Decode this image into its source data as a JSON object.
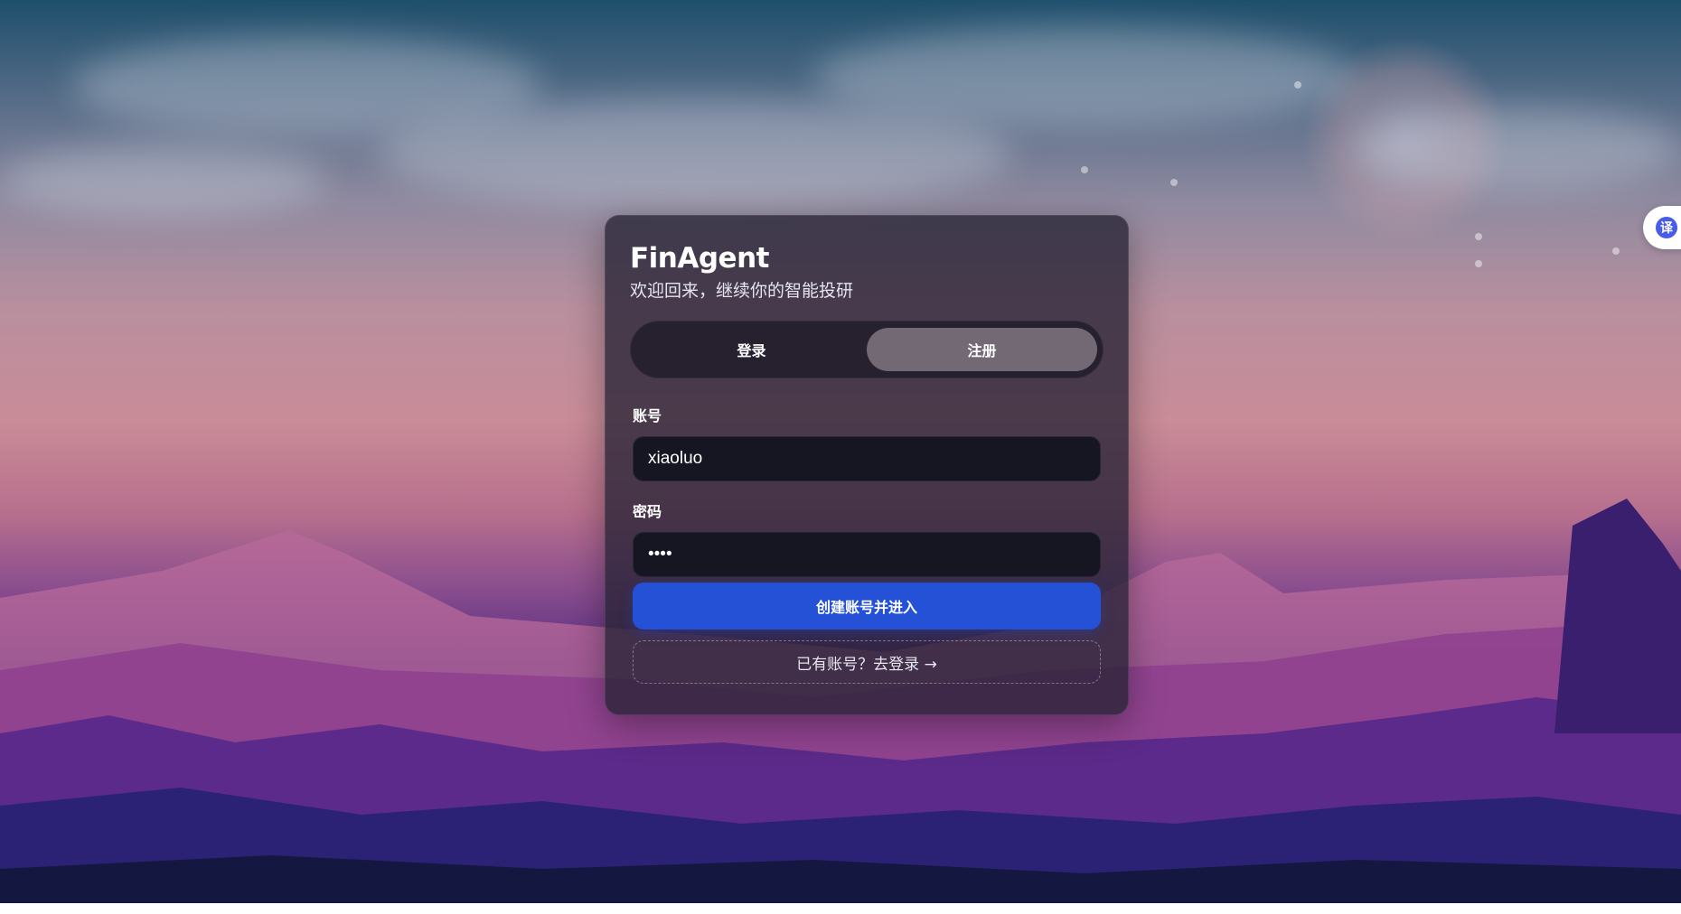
{
  "app": {
    "title": "FinAgent",
    "subtitle": "欢迎回来，继续你的智能投研"
  },
  "tabs": [
    {
      "label": "登录",
      "active": false
    },
    {
      "label": "注册",
      "active": true
    }
  ],
  "form": {
    "account_label": "账号",
    "account_value": "xiaoluo",
    "password_label": "密码",
    "password_value": "••••",
    "submit_label": "创建账号并进入",
    "switch_label": "已有账号？去登录 →"
  },
  "translate_widget": {
    "label": "译",
    "icon": "translate-icon"
  },
  "colors": {
    "accent": "#2451d6",
    "card_bg": "#262234",
    "tab_active": "#807680",
    "translate_icon": "#4a5be8"
  }
}
